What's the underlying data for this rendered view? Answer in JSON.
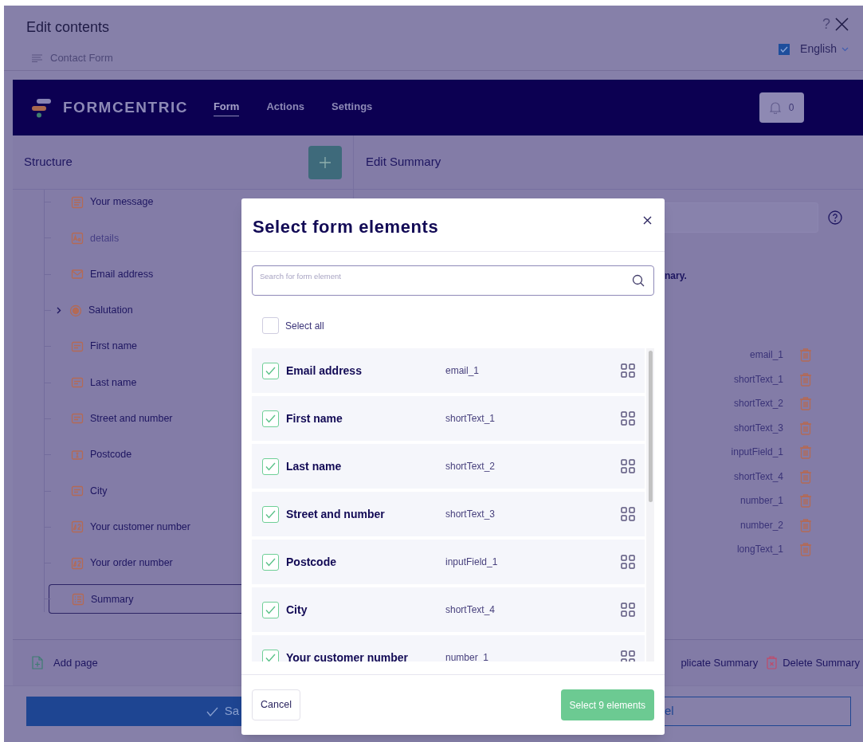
{
  "window": {
    "title": "Edit contents",
    "subtitle": "Contact Form",
    "help": "?",
    "language": {
      "checked": true,
      "label": "English"
    }
  },
  "nav": {
    "brand": "FORMCENTRIC",
    "tabs": [
      {
        "label": "Form",
        "selected": true
      },
      {
        "label": "Actions",
        "selected": false
      },
      {
        "label": "Settings",
        "selected": false
      }
    ],
    "notifications": "0"
  },
  "structure": {
    "title": "Structure",
    "items": [
      {
        "label": "Your message",
        "kind": "longtext",
        "disabled": false,
        "selected": false
      },
      {
        "label": "details",
        "kind": "textblock",
        "disabled": true,
        "selected": false
      },
      {
        "label": "Email address",
        "kind": "email",
        "disabled": false,
        "selected": false
      },
      {
        "label": "Salutation",
        "kind": "radio",
        "disabled": false,
        "selected": false,
        "expanded": false
      },
      {
        "label": "First name",
        "kind": "shorttext",
        "disabled": false,
        "selected": false
      },
      {
        "label": "Last name",
        "kind": "shorttext",
        "disabled": false,
        "selected": false
      },
      {
        "label": "Street and number",
        "kind": "shorttext",
        "disabled": false,
        "selected": false
      },
      {
        "label": "Postcode",
        "kind": "input",
        "disabled": false,
        "selected": false
      },
      {
        "label": "City",
        "kind": "shorttext",
        "disabled": false,
        "selected": false
      },
      {
        "label": "Your customer number",
        "kind": "number",
        "disabled": false,
        "selected": false
      },
      {
        "label": "Your order number",
        "kind": "number",
        "disabled": false,
        "selected": false
      },
      {
        "label": "Summary",
        "kind": "summary",
        "disabled": false,
        "selected": true
      }
    ],
    "add_page": "Add page"
  },
  "editor": {
    "title": "Edit Summary",
    "note": "nary.",
    "elements": [
      "email_1",
      "shortText_1",
      "shortText_2",
      "shortText_3",
      "inputField_1",
      "shortText_4",
      "number_1",
      "number_2",
      "longText_1"
    ],
    "duplicate": "plicate Summary",
    "delete": "Delete Summary"
  },
  "footer": {
    "save": "Sa",
    "cancel": "el"
  },
  "dialog": {
    "title": "Select form elements",
    "search_placeholder": "Search for form element",
    "select_all": {
      "label": "Select all",
      "checked": false
    },
    "items": [
      {
        "label": "Email address",
        "id": "email_1",
        "checked": true
      },
      {
        "label": "First name",
        "id": "shortText_1",
        "checked": true
      },
      {
        "label": "Last name",
        "id": "shortText_2",
        "checked": true
      },
      {
        "label": "Street and number",
        "id": "shortText_3",
        "checked": true
      },
      {
        "label": "Postcode",
        "id": "inputField_1",
        "checked": true
      },
      {
        "label": "City",
        "id": "shortText_4",
        "checked": true
      },
      {
        "label": "Your customer number",
        "id": "number_1",
        "checked": true
      }
    ],
    "cancel": "Cancel",
    "confirm": "Select 9 elements"
  }
}
